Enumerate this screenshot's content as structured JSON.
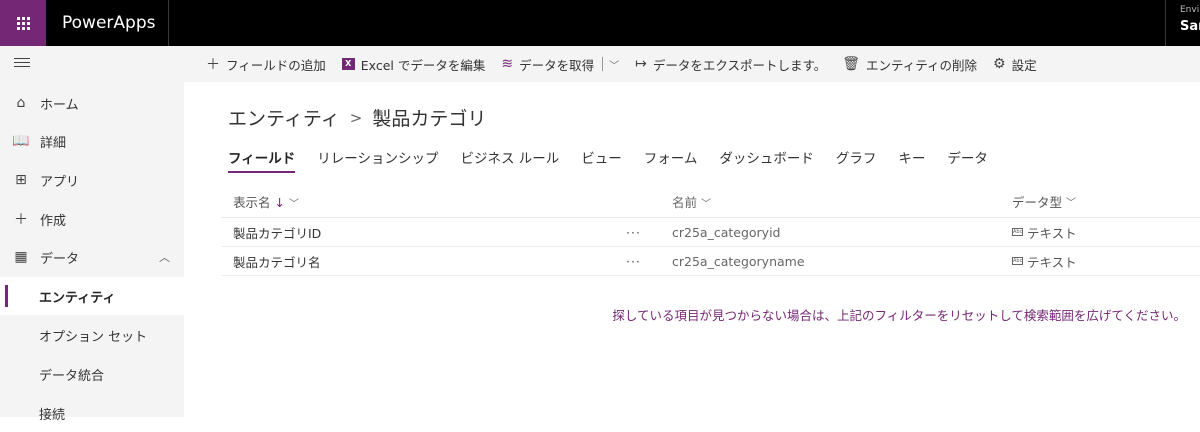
{
  "header": {
    "app_title": "PowerApps",
    "env_label": "Envi",
    "env_name": "San"
  },
  "nav": {
    "items": [
      {
        "label": "ホーム",
        "icon": "home-icon"
      },
      {
        "label": "詳細",
        "icon": "book-icon"
      },
      {
        "label": "アプリ",
        "icon": "apps-icon"
      },
      {
        "label": "作成",
        "icon": "plus-icon"
      },
      {
        "label": "データ",
        "icon": "table-icon"
      }
    ],
    "subitems": [
      {
        "label": "エンティティ",
        "selected": true
      },
      {
        "label": "オプション セット"
      },
      {
        "label": "データ統合"
      },
      {
        "label": "接続"
      }
    ]
  },
  "commands": {
    "add_field": "フィールドの追加",
    "edit_excel": "Excel でデータを編集",
    "get_data": "データを取得",
    "export_data": "データをエクスポートします。",
    "delete_entity": "エンティティの削除",
    "settings": "設定"
  },
  "breadcrumb": {
    "parent": "エンティティ",
    "separator": ">",
    "current": "製品カテゴリ"
  },
  "tabs": [
    "フィールド",
    "リレーションシップ",
    "ビジネス ルール",
    "ビュー",
    "フォーム",
    "ダッシュボード",
    "グラフ",
    "キー",
    "データ"
  ],
  "table": {
    "headers": {
      "display_name": "表示名",
      "name": "名前",
      "data_type": "データ型"
    },
    "rows": [
      {
        "display_name": "製品カテゴリID",
        "more": "···",
        "name": "cr25a_categoryid",
        "data_type": "テキスト"
      },
      {
        "display_name": "製品カテゴリ名",
        "more": "···",
        "name": "cr25a_categoryname",
        "data_type": "テキスト"
      }
    ]
  },
  "hint": "探している項目が見つからない場合は、上記のフィルターをリセットして検索範囲を広げてください。",
  "colors": {
    "accent": "#742774",
    "topbar": "#000000",
    "nav_bg": "#f4f4f4"
  }
}
